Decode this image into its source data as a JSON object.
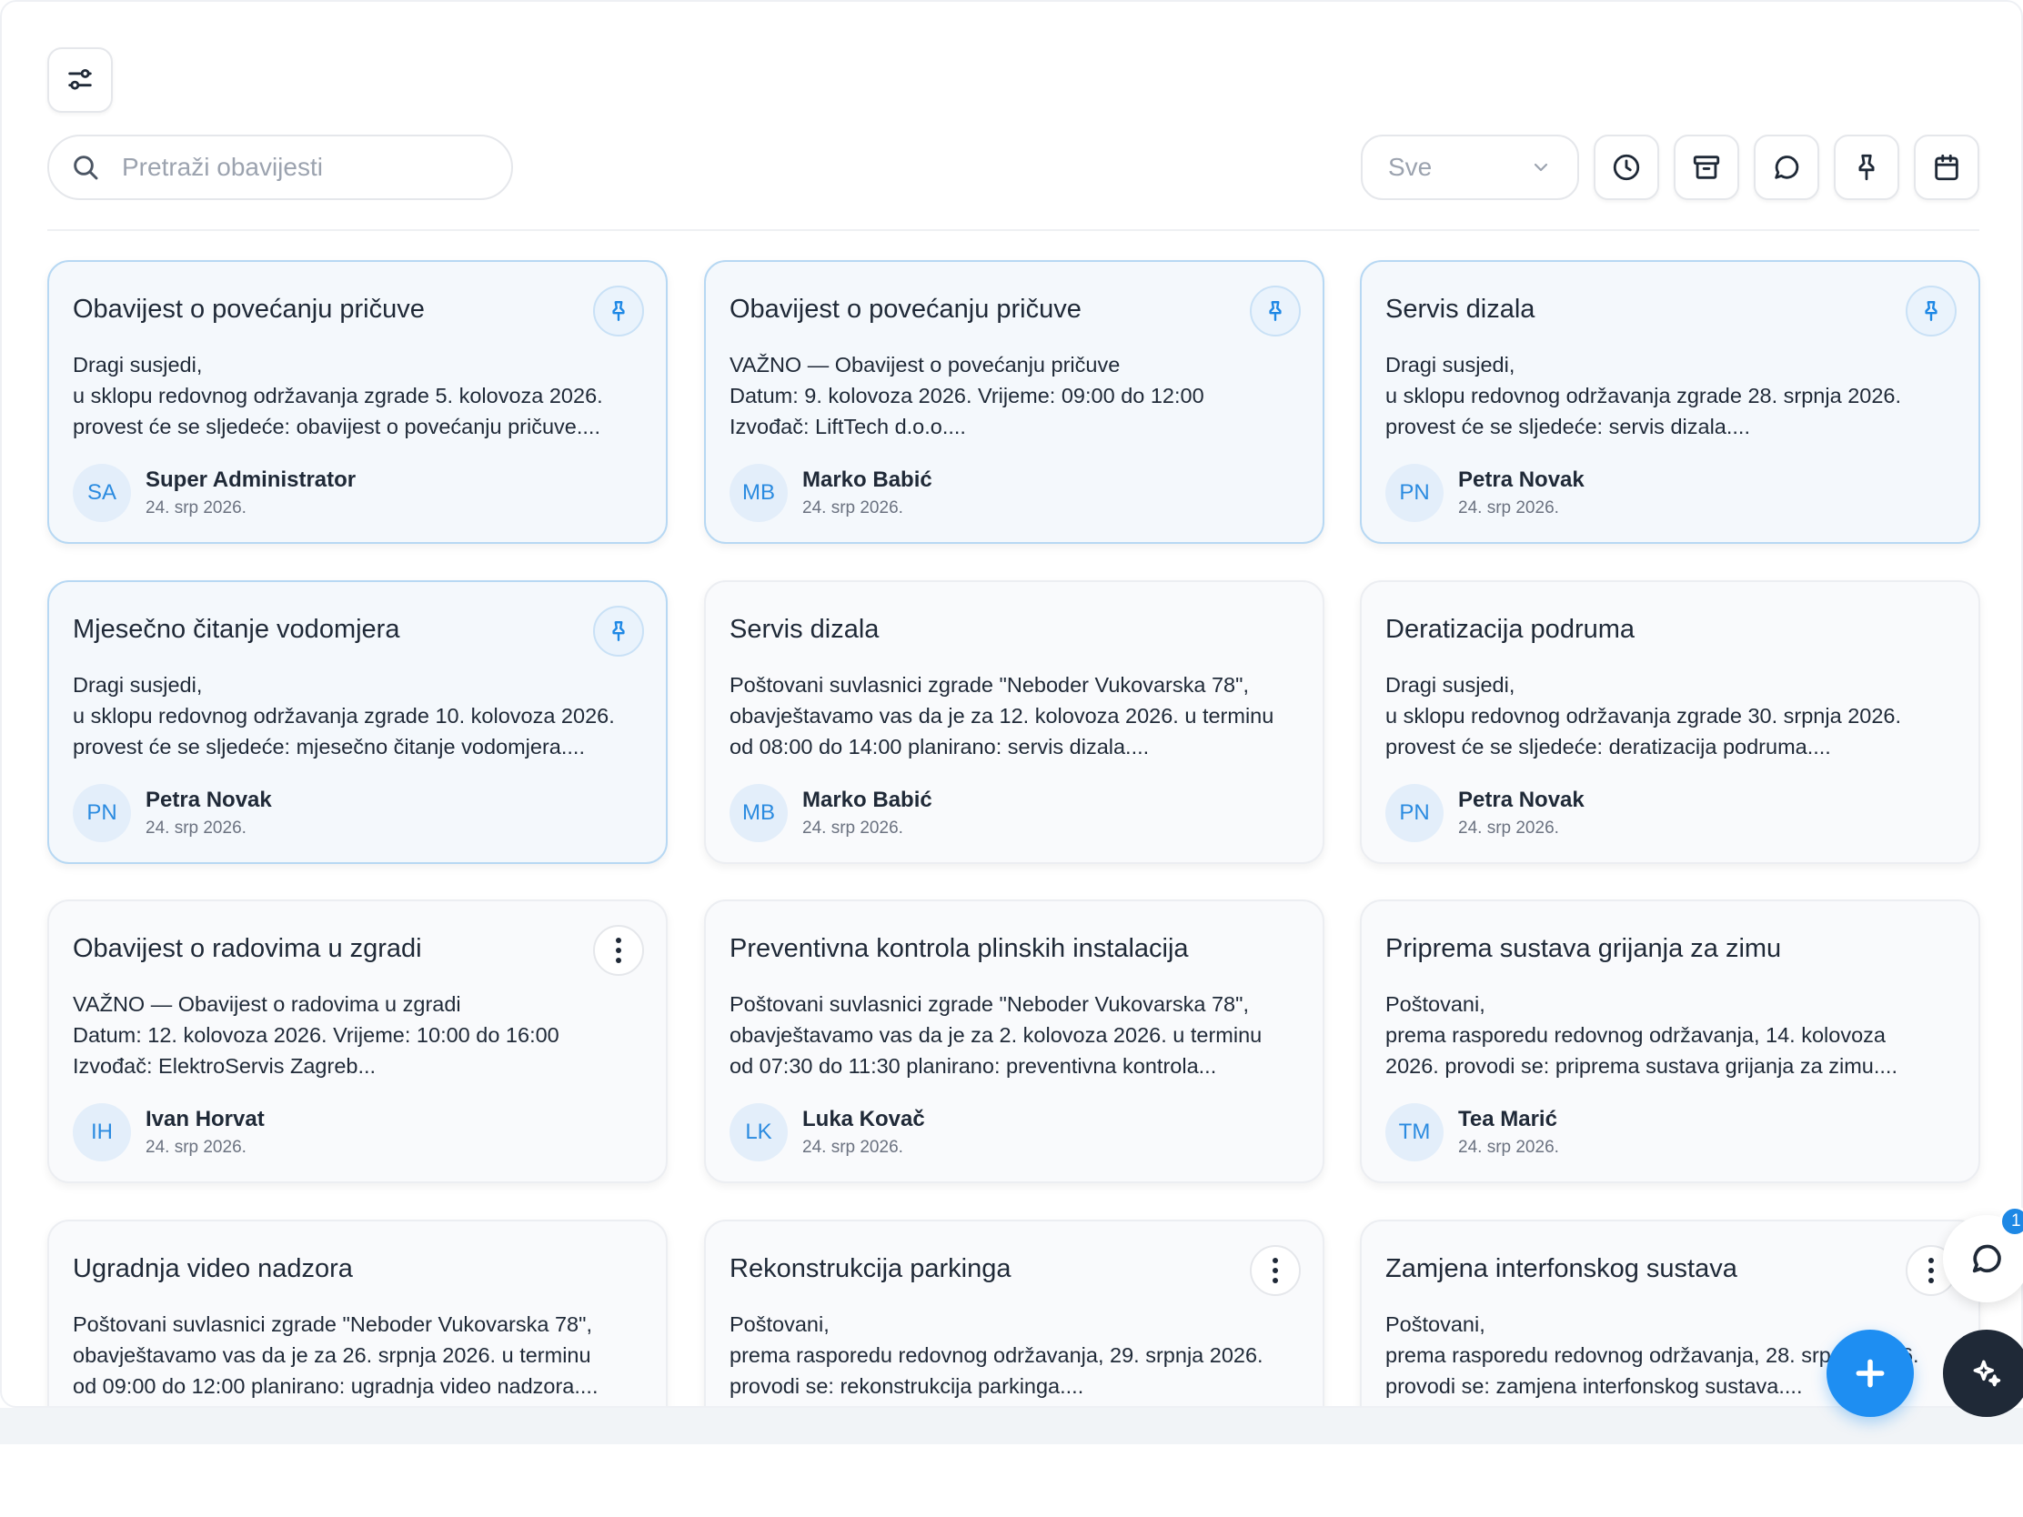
{
  "toolbar": {
    "search_placeholder": "Pretraži obavijesti",
    "filter_selected": "Sve"
  },
  "cards": [
    {
      "title": "Obavijest o povećanju pričuve",
      "pinned": true,
      "body": [
        "Dragi susjedi,",
        "u sklopu redovnog održavanja zgrade 5. kolovoza 2026.",
        "provest će se sljedeće: obavijest o povećanju pričuve...."
      ],
      "author_initials": "SA",
      "author_name": "Super Administrator",
      "date": "24. srp 2026."
    },
    {
      "title": "Obavijest o povećanju pričuve",
      "pinned": true,
      "body": [
        "VAŽNO — Obavijest o povećanju pričuve",
        "Datum: 9. kolovoza 2026. Vrijeme: 09:00 do 12:00",
        "Izvođač: LiftTech d.o.o...."
      ],
      "author_initials": "MB",
      "author_name": "Marko Babić",
      "date": "24. srp 2026."
    },
    {
      "title": "Servis dizala",
      "pinned": true,
      "body": [
        "Dragi susjedi,",
        "u sklopu redovnog održavanja zgrade 28. srpnja 2026.",
        "provest će se sljedeće: servis dizala...."
      ],
      "author_initials": "PN",
      "author_name": "Petra Novak",
      "date": "24. srp 2026."
    },
    {
      "title": "Mjesečno čitanje vodomjera",
      "pinned": true,
      "body": [
        "Dragi susjedi,",
        "u sklopu redovnog održavanja zgrade 10. kolovoza 2026.",
        "provest će se sljedeće: mjesečno čitanje vodomjera...."
      ],
      "author_initials": "PN",
      "author_name": "Petra Novak",
      "date": "24. srp 2026."
    },
    {
      "title": "Servis dizala",
      "pinned": false,
      "body": [
        "Poštovani suvlasnici zgrade \"Neboder Vukovarska 78\",",
        "obavještavamo vas da je za 12. kolovoza 2026. u terminu",
        "od 08:00 do 14:00 planirano: servis dizala...."
      ],
      "author_initials": "MB",
      "author_name": "Marko Babić",
      "date": "24. srp 2026."
    },
    {
      "title": "Deratizacija podruma",
      "pinned": false,
      "body": [
        "Dragi susjedi,",
        "u sklopu redovnog održavanja zgrade 30. srpnja 2026.",
        "provest će se sljedeće: deratizacija podruma...."
      ],
      "author_initials": "PN",
      "author_name": "Petra Novak",
      "date": "24. srp 2026."
    },
    {
      "title": "Obavijest o radovima u zgradi",
      "pinned": false,
      "menu": true,
      "body": [
        "VAŽNO — Obavijest o radovima u zgradi",
        "Datum: 12. kolovoza 2026. Vrijeme: 10:00 do 16:00",
        "Izvođač: ElektroServis Zagreb..."
      ],
      "author_initials": "IH",
      "author_name": "Ivan Horvat",
      "date": "24. srp 2026."
    },
    {
      "title": "Preventivna kontrola plinskih instalacija",
      "pinned": false,
      "body": [
        "Poštovani suvlasnici zgrade \"Neboder Vukovarska 78\",",
        "obavještavamo vas da je za 2. kolovoza 2026. u terminu",
        "od 07:30 do 11:30 planirano: preventivna kontrola..."
      ],
      "author_initials": "LK",
      "author_name": "Luka Kovač",
      "date": "24. srp 2026."
    },
    {
      "title": "Priprema sustava grijanja za zimu",
      "pinned": false,
      "body": [
        "Poštovani,",
        "prema rasporedu redovnog održavanja, 14. kolovoza",
        "2026. provodi se: priprema sustava grijanja za zimu...."
      ],
      "author_initials": "TM",
      "author_name": "Tea Marić",
      "date": "24. srp 2026."
    },
    {
      "title": "Ugradnja video nadzora",
      "pinned": false,
      "body": [
        "Poštovani suvlasnici zgrade \"Neboder Vukovarska 78\",",
        "obavještavamo vas da je za 26. srpnja 2026. u terminu",
        "od 09:00 do 12:00 planirano: ugradnja video nadzora...."
      ],
      "author_initials": "",
      "author_name": "",
      "date": ""
    },
    {
      "title": "Rekonstrukcija parkinga",
      "pinned": false,
      "menu": true,
      "body": [
        "Poštovani,",
        "prema rasporedu redovnog održavanja, 29. srpnja 2026.",
        "provodi se: rekonstrukcija parkinga...."
      ],
      "author_initials": "",
      "author_name": "",
      "date": ""
    },
    {
      "title": "Zamjena interfonskog sustava",
      "pinned": false,
      "menu": true,
      "body": [
        "Poštovani,",
        "prema rasporedu redovnog održavanja, 28. srpnja 2026.",
        "provodi se: zamjena interfonskog sustava...."
      ],
      "author_initials": "",
      "author_name": "",
      "date": ""
    }
  ],
  "chat": {
    "badge_count": "1"
  },
  "icons": {
    "filter_toggle": "sliders-icon",
    "search": "search-icon",
    "history": "clock-icon",
    "archive": "archive-icon",
    "comments": "message-icon",
    "pinned": "pin-icon",
    "calendar": "calendar-icon",
    "add": "plus-icon",
    "ai": "sparkles-icon"
  },
  "colors": {
    "accent": "#1e8ef2",
    "pinned_border": "#b7d8f3",
    "avatar_bg": "#e3eefa",
    "avatar_text": "#2b8be0"
  }
}
